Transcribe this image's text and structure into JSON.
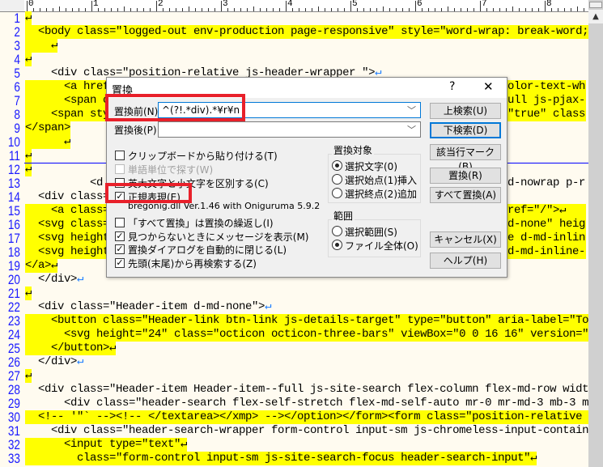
{
  "ruler": {
    "labels": [
      "0",
      "1",
      "2",
      "3",
      "4",
      "5",
      "6",
      "7",
      "8"
    ]
  },
  "editor": {
    "return_glyph": "↵",
    "lines": [
      {
        "n": "1",
        "text": "",
        "hl": true,
        "ret": true
      },
      {
        "n": "2",
        "text": "  <body class=\"logged-out env-production page-responsive\" style=\"word-wrap: break-word;",
        "hl": true,
        "ret": false
      },
      {
        "n": "3",
        "text": "    ",
        "hl": true,
        "ret": true
      },
      {
        "n": "4",
        "text": "",
        "hl": true,
        "ret": true
      },
      {
        "n": "5",
        "text": "    <div class=\"position-relative js-header-wrapper \">",
        "hl": false,
        "ret": true
      },
      {
        "n": "6",
        "text": "      <a href",
        "hl": true,
        "ret": false,
        "right": "olor-text-whi"
      },
      {
        "n": "7",
        "text": "      <span c",
        "hl": true,
        "ret": false,
        "right": "ull js-pjax-l"
      },
      {
        "n": "8",
        "text": "    <span sty",
        "hl": true,
        "ret": false,
        "right": "\"true\" class"
      },
      {
        "n": "9",
        "text": "</span>",
        "hl": true,
        "ret": false
      },
      {
        "n": "10",
        "text": "      ",
        "hl": true,
        "ret": true
      },
      {
        "n": "11",
        "text": "",
        "hl": true,
        "ret": true
      },
      {
        "n": "12",
        "text": "",
        "hl": true,
        "ret": true
      },
      {
        "n": "13",
        "text": "          <d",
        "hl": false,
        "ret": false,
        "right": "d-nowrap p-re"
      },
      {
        "n": "14",
        "text": "  <div class=",
        "hl": false,
        "ret": false
      },
      {
        "n": "15",
        "text": "    <a class=",
        "hl": true,
        "ret": false,
        "right": "ref=\"/\">↵"
      },
      {
        "n": "16",
        "text": "  <svg class=",
        "hl": true,
        "ret": false,
        "right": "d-none\" heig"
      },
      {
        "n": "17",
        "text": "  <svg height",
        "hl": true,
        "ret": false,
        "right": "e d-md-inline"
      },
      {
        "n": "18",
        "text": "  <svg height",
        "hl": true,
        "ret": false,
        "right": "d-md-inline-b"
      },
      {
        "n": "19",
        "text": "</a>",
        "hl": true,
        "ret": true
      },
      {
        "n": "20",
        "text": "  </div>",
        "hl": false,
        "ret": true
      },
      {
        "n": "21",
        "text": "",
        "hl": true,
        "ret": true
      },
      {
        "n": "22",
        "text": "  <div class=\"Header-item d-md-none\">",
        "hl": false,
        "ret": true
      },
      {
        "n": "23",
        "text": "    <button class=\"Header-link btn-link js-details-target\" type=\"button\" aria-label=\"To",
        "hl": true,
        "ret": false
      },
      {
        "n": "24",
        "text": "      <svg height=\"24\" class=\"octicon octicon-three-bars\" viewBox=\"0 0 16 16\" version=\"",
        "hl": true,
        "ret": false
      },
      {
        "n": "25",
        "text": "    </button>",
        "hl": true,
        "ret": true
      },
      {
        "n": "26",
        "text": "  </div>",
        "hl": false,
        "ret": true
      },
      {
        "n": "27",
        "text": "",
        "hl": true,
        "ret": true
      },
      {
        "n": "28",
        "text": "  <div class=\"Header-item Header-item--full js-site-search flex-column flex-md-row widt",
        "hl": false,
        "ret": false
      },
      {
        "n": "29",
        "text": "      <div class=\"header-search flex-self-stretch flex-md-self-auto mr-0 mr-md-3 mb-3 m",
        "hl": false,
        "ret": false
      },
      {
        "n": "30",
        "text": "  <!-- '\"` --><!-- </textarea></xmp> --></option></form><form class=\"position-relative ",
        "hl": true,
        "ret": false
      },
      {
        "n": "31",
        "text": "    <div class=\"header-search-wrapper form-control input-sm js-chromeless-input-contain",
        "hl": false,
        "ret": false
      },
      {
        "n": "32",
        "text": "      <input type=\"text\"",
        "hl": true,
        "ret": true
      },
      {
        "n": "33",
        "text": "        class=\"form-control input-sm js-site-search-focus header-search-input\"",
        "hl": true,
        "ret": true
      }
    ]
  },
  "dialog": {
    "title": "置換",
    "help": "?",
    "close": "✕",
    "find_label": "置換前(N)",
    "find_value": "^(?!.*div).*¥r¥n",
    "replace_label": "置換後(P)",
    "replace_value": "",
    "chevron": "﹀",
    "checkboxes": [
      {
        "label": "クリップボードから貼り付ける(T)",
        "checked": false,
        "disabled": false
      },
      {
        "label": "単語単位で探す(W)",
        "checked": false,
        "disabled": true
      },
      {
        "label": "英大文字と小文字を区別する(C)",
        "checked": false,
        "disabled": false
      },
      {
        "label": "正規表現(E)",
        "checked": true,
        "disabled": false
      },
      {
        "label": "「すべて置換」は置換の繰返し(I)",
        "checked": false,
        "disabled": false
      },
      {
        "label": "見つからないときにメッセージを表示(M)",
        "checked": true,
        "disabled": false
      },
      {
        "label": "置換ダイアログを自動的に閉じる(L)",
        "checked": true,
        "disabled": false
      },
      {
        "label": "先頭(末尾)から再検索する(Z)",
        "checked": true,
        "disabled": false
      }
    ],
    "regex_lib": "bregonig.dll Ver.1.46 with Oniguruma 5.9.2",
    "target_group": {
      "title": "置換対象",
      "options": [
        {
          "label": "選択文字(0)",
          "selected": true
        },
        {
          "label": "選択始点(1)挿入",
          "selected": false
        },
        {
          "label": "選択終点(2)追加",
          "selected": false
        }
      ]
    },
    "range_group": {
      "title": "範囲",
      "options": [
        {
          "label": "選択範囲(S)",
          "selected": false
        },
        {
          "label": "ファイル全体(O)",
          "selected": true
        }
      ]
    },
    "buttons": {
      "search_up": "上検索(U)",
      "search_down": "下検索(D)",
      "mark": "該当行マーク(B)",
      "replace": "置換(R)",
      "replace_all": "すべて置換(A)",
      "cancel": "キャンセル(X)",
      "help": "ヘルプ(H)"
    }
  },
  "colors": {
    "highlight": "#ffff00",
    "line_numbers": "#1a1aff",
    "annotation": "#e8202a",
    "editor_bg": "#fffbf0"
  }
}
